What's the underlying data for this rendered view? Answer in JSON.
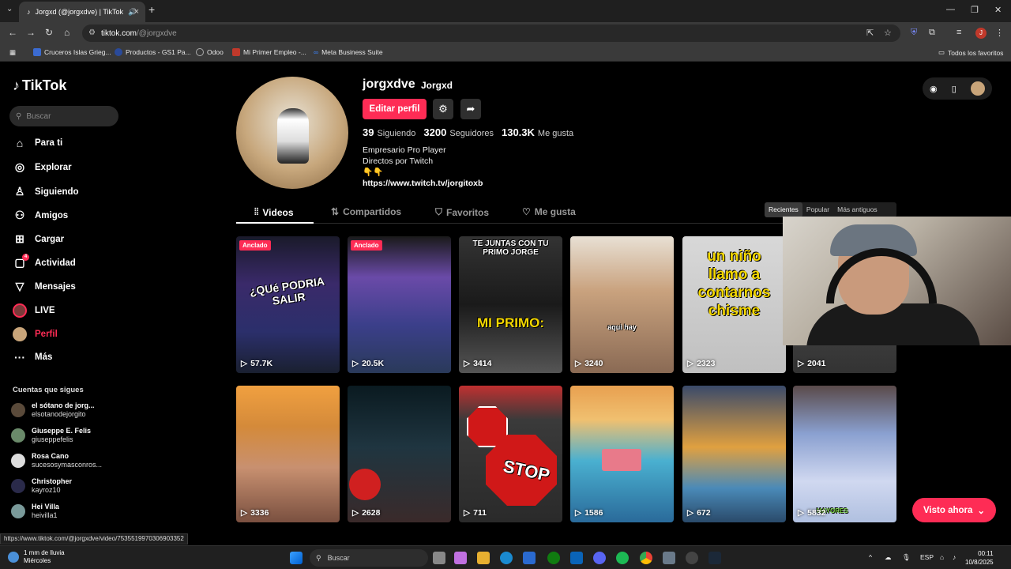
{
  "browser": {
    "tab_title": "Jorgxd (@jorgxdve) | TikTok",
    "url_host": "tiktok.com",
    "url_path": "/@jorgxdve",
    "bookmarks": [
      "Cruceros Islas Grieg...",
      "Productos - GS1 Pa...",
      "Odoo",
      "Mi Primer Empleo -...",
      "Meta Business Suite"
    ],
    "all_favorites": "Todos los favoritos",
    "status_url": "https://www.tiktok.com/@jorgxdve/video/7535519970306903352"
  },
  "sidebar": {
    "logo": "TikTok",
    "search_placeholder": "Buscar",
    "nav": [
      {
        "label": "Para ti",
        "icon": "home-icon"
      },
      {
        "label": "Explorar",
        "icon": "compass-icon"
      },
      {
        "label": "Siguiendo",
        "icon": "following-icon"
      },
      {
        "label": "Amigos",
        "icon": "friends-icon"
      },
      {
        "label": "Cargar",
        "icon": "upload-icon"
      },
      {
        "label": "Actividad",
        "icon": "activity-icon",
        "badge": "4"
      },
      {
        "label": "Mensajes",
        "icon": "messages-icon"
      },
      {
        "label": "LIVE",
        "icon": "live-icon"
      },
      {
        "label": "Perfil",
        "icon": "profile-icon"
      },
      {
        "label": "Más",
        "icon": "more-icon"
      }
    ],
    "following_title": "Cuentas que sigues",
    "following": [
      {
        "name": "el sótano de jorg...",
        "handle": "elsotanodejorgito"
      },
      {
        "name": "Giuseppe E. Felis",
        "handle": "giuseppefelis"
      },
      {
        "name": "Rosa Cano",
        "handle": "sucesosymasconros..."
      },
      {
        "name": "Christopher",
        "handle": "kayroz10"
      },
      {
        "name": "Hei Villa",
        "handle": "heivilla1"
      }
    ]
  },
  "profile": {
    "username": "jorgxdve",
    "display_name": "Jorgxd",
    "edit_button": "Editar perfil",
    "following_count": "39",
    "following_label": "Siguiendo",
    "followers_count": "3200",
    "followers_label": "Seguidores",
    "likes_count": "130.3K",
    "likes_label": "Me gusta",
    "bio_line1": "Empresario Pro Player",
    "bio_line2": "Directos por Twitch",
    "bio_emoji": "👇👇",
    "link": "https://www.twitch.tv/jorgitoxb"
  },
  "tabs": [
    "Videos",
    "Compartidos",
    "Favoritos",
    "Me gusta"
  ],
  "sort": [
    "Recientes",
    "Popular",
    "Más antiguos"
  ],
  "videos": [
    {
      "views": "57.7K",
      "pinned": "Anclado",
      "caption": "¿QUé PODRIA SALIR",
      "bg": "#2b2f6b"
    },
    {
      "views": "20.5K",
      "pinned": "Anclado",
      "caption": "",
      "bg": "#3b3f8a"
    },
    {
      "views": "3414",
      "caption_top": "TE JUNTAS CON TU PRIMO JORGE",
      "caption": "MI PRIMO:",
      "bg": "#2a2a2a"
    },
    {
      "views": "3240",
      "caption": "aqui hay",
      "bg": "#8a7a6a"
    },
    {
      "views": "2323",
      "caption": "un niño llamo a contarnos chisme",
      "bg": "#cfcfcf"
    },
    {
      "views": "2041",
      "caption": "",
      "bg": "#444"
    },
    {
      "views": "3336",
      "caption": "",
      "bg": "#d48a3a"
    },
    {
      "views": "2628",
      "caption": "",
      "bg": "#1f3540"
    },
    {
      "views": "711",
      "caption": "STOP",
      "bg": "#3a3a3a"
    },
    {
      "views": "1586",
      "caption": "",
      "bg": "#e87a3a"
    },
    {
      "views": "672",
      "caption": "",
      "bg": "#4a7ab8"
    },
    {
      "views": "5832",
      "caption": "MAYORES",
      "bg": "#a0b0d8"
    }
  ],
  "watch_now": "Visto ahora",
  "taskbar": {
    "weather_line1": "1 mm de lluvia",
    "weather_line2": "Miércoles",
    "search": "Buscar",
    "lang": "ESP",
    "time": "00:11",
    "date": "10/8/2025"
  }
}
